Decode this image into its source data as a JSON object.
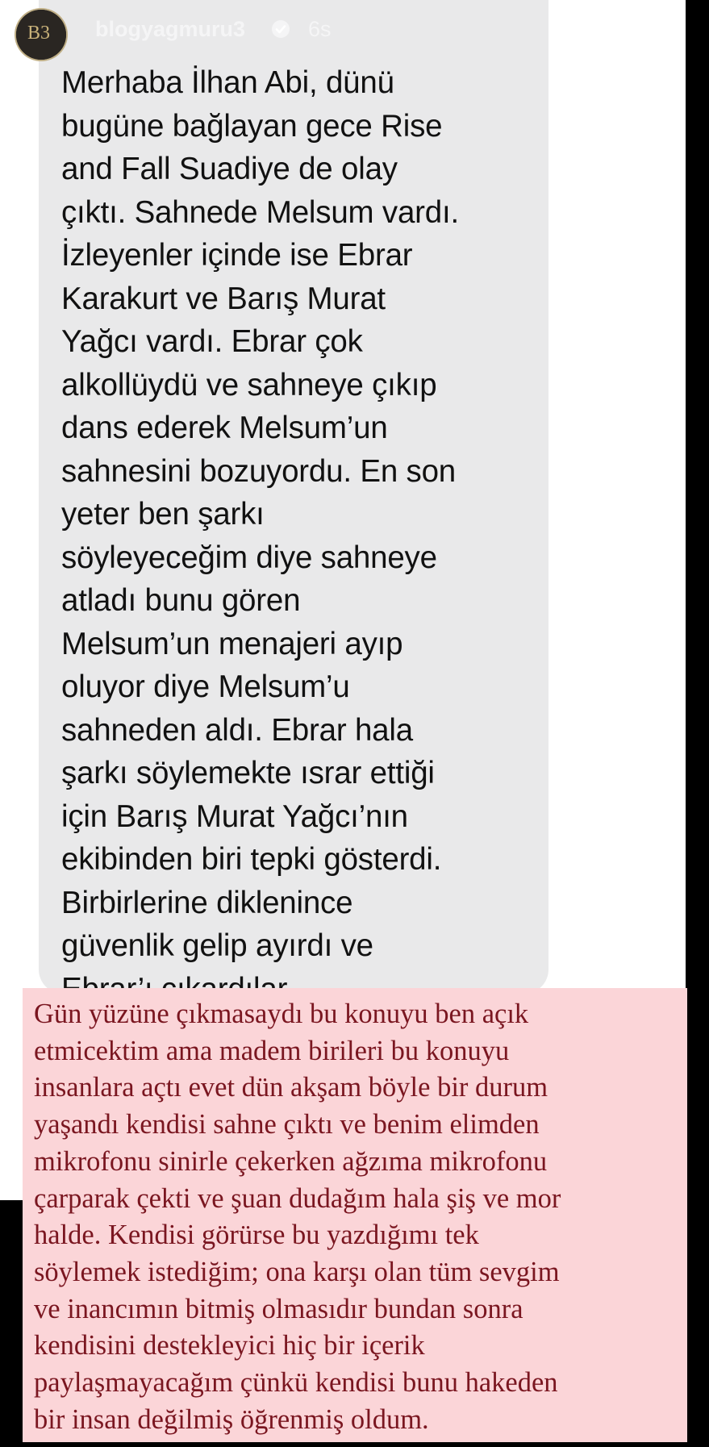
{
  "header": {
    "username": "blogyagmuru3",
    "time_ago": "6s",
    "avatar_monogram": "B3"
  },
  "message": {
    "lines": [
      "Merhaba İlhan Abi, dünü",
      "bugüne bağlayan gece Rise",
      "and Fall Suadiye de olay",
      "çıktı. Sahnede Melsum vardı.",
      "İzleyenler içinde ise Ebrar",
      "Karakurt ve Barış Murat",
      "Yağcı vardı. Ebrar çok",
      "alkollüydü ve sahneye çıkıp",
      "dans ederek Melsum’un",
      "sahnesini bozuyordu. En son",
      "yeter ben şarkı",
      "söyleyeceğim diye sahneye",
      "atladı bunu gören",
      "Melsum’un menajeri ayıp",
      "oluyor diye Melsum’u",
      "sahneden aldı. Ebrar hala",
      "şarkı söylemekte ısrar ettiği",
      "için Barış Murat Yağcı’nın",
      "ekibinden biri tepki gösterdi.",
      "Birbirlerine diklenince",
      "güvenlik gelip ayırdı ve",
      "Ebrar’ı çıkardılar."
    ]
  },
  "caption": {
    "lines": [
      "Gün yüzüne çıkmasaydı bu konuyu ben açık",
      "etmicektim ama madem birileri bu konuyu",
      "insanlara açtı evet dün akşam böyle bir durum",
      "yaşandı kendisi sahne çıktı ve benim elimden",
      "mikrofonu sinirle çekerken ağzıma mikrofonu",
      "çarparak çekti ve şuan dudağım hala şiş ve mor",
      "halde. Kendisi görürse bu yazdığımı tek",
      "söylemek istediğim; ona karşı olan tüm sevgim",
      "ve inancımın bitmiş olmasıdır bundan sonra",
      "kendisini destekleyici hiç bir içerik",
      "paylaşmayacağım çünkü kendisi bunu hakeden",
      "bir insan değilmiş öğrenmiş oldum."
    ]
  },
  "colors": {
    "background": "#000000",
    "card": "#ffffff",
    "bubble": "#e9e9ea",
    "caption_bg": "#fbd5d8",
    "caption_text": "#7a1620"
  },
  "icons": [
    "verified-badge-icon",
    "more-options-icon",
    "close-icon"
  ]
}
